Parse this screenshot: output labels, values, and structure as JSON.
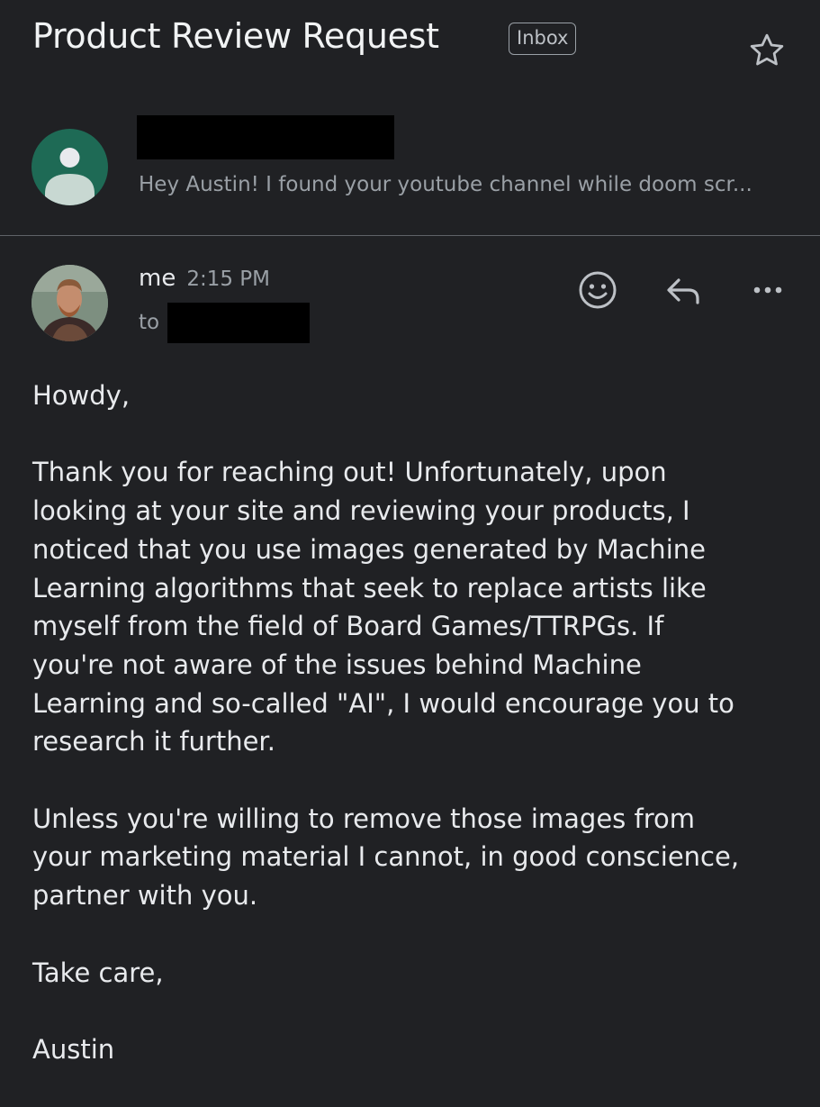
{
  "thread": {
    "subject": "Product Review Request",
    "label": "Inbox",
    "star_icon": "star-outline-icon"
  },
  "collapsed_message": {
    "avatar_icon": "person-icon",
    "snippet": "Hey Austin! I found your youtube channel while doom scr..."
  },
  "open_message": {
    "sender": "me",
    "time": "2:15 PM",
    "to_label": "to",
    "actions": {
      "react_icon": "smiley-icon",
      "reply_icon": "reply-icon",
      "more_icon": "more-horizontal-icon"
    },
    "body": {
      "greeting": "Howdy,",
      "paragraph1_lines": [
        "Thank you for reaching out! Unfortunately, upon",
        "looking at your site and reviewing your products, I",
        "noticed that you use images generated by Machine",
        "Learning algorithms that seek to replace artists like",
        "myself from the field of Board Games/TTRPGs. If",
        "you're not aware of the issues behind Machine",
        "Learning and so-called \"AI\", I would encourage you to",
        "research it further."
      ],
      "paragraph2_lines": [
        "Unless you're willing to remove those images from",
        "your marketing material I cannot, in good conscience,",
        "partner with you."
      ],
      "closing": "Take care,",
      "signature": "Austin"
    }
  },
  "colors": {
    "background": "#202124",
    "text": "#e8eaed",
    "muted": "#9aa0a6",
    "avatar_green": "#1e6a55"
  }
}
